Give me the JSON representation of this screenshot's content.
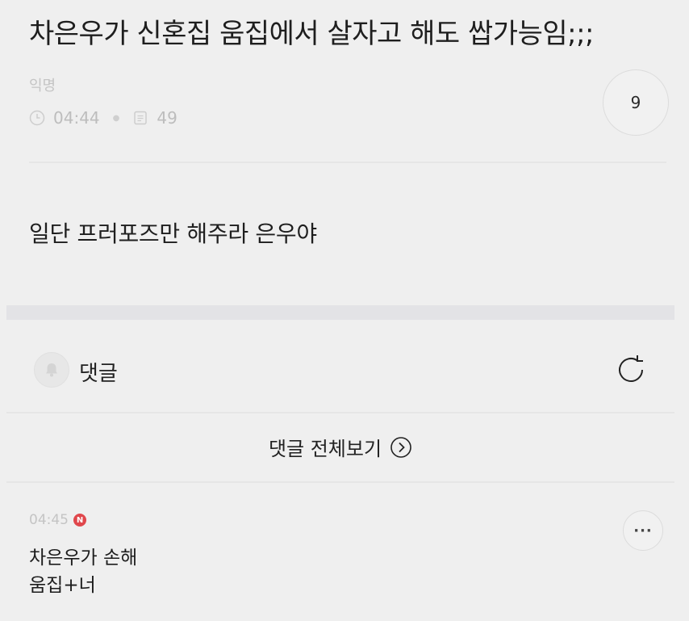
{
  "post": {
    "title": "차은우가 신혼집 움집에서 살자고 해도 쌉가능임;;;",
    "author": "익명",
    "time": "04:44",
    "views": "49",
    "comment_count": "9",
    "body": "일단 프러포즈만 해주라 은우야"
  },
  "comments_section": {
    "label": "댓글",
    "view_all_label": "댓글 전체보기"
  },
  "comment": {
    "time": "04:45",
    "badge": "N",
    "lines": [
      "차은우가 손해",
      "움집+너"
    ],
    "more_label": "···"
  },
  "colors": {
    "background": "#efefef",
    "new_badge": "#e0474c",
    "muted_text": "#c4c4c4"
  },
  "icons": [
    "clock-icon",
    "document-icon",
    "bell-icon",
    "refresh-icon",
    "chevron-right-circle-icon",
    "more-icon"
  ]
}
